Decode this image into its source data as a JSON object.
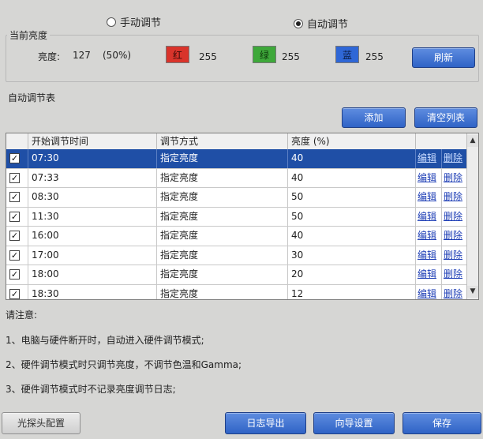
{
  "mode": {
    "manual_label": "手动调节",
    "auto_label": "自动调节",
    "selected": "auto"
  },
  "current": {
    "group_title": "当前亮度",
    "brightness_label": "亮度:",
    "brightness_value": "127",
    "brightness_percent": "(50%)",
    "red_label": "红",
    "red_value": "255",
    "green_label": "绿",
    "green_value": "255",
    "blue_label": "蓝",
    "blue_value": "255",
    "red_color": "#d9342b",
    "green_color": "#3ea83a",
    "blue_color": "#2f67d6",
    "refresh_label": "刷新"
  },
  "auto_table": {
    "group_title": "自动调节表",
    "add_label": "添加",
    "clear_label": "清空列表",
    "headers": [
      "开始调节时间",
      "调节方式",
      "亮度 (%)"
    ],
    "edit_label": "编辑",
    "delete_label": "删除",
    "rows": [
      {
        "time": "07:30",
        "method": "指定亮度",
        "brightness": "40",
        "checked": true,
        "selected": true
      },
      {
        "time": "07:33",
        "method": "指定亮度",
        "brightness": "40",
        "checked": true,
        "selected": false
      },
      {
        "time": "08:30",
        "method": "指定亮度",
        "brightness": "50",
        "checked": true,
        "selected": false
      },
      {
        "time": "11:30",
        "method": "指定亮度",
        "brightness": "50",
        "checked": true,
        "selected": false
      },
      {
        "time": "16:00",
        "method": "指定亮度",
        "brightness": "40",
        "checked": true,
        "selected": false
      },
      {
        "time": "17:00",
        "method": "指定亮度",
        "brightness": "30",
        "checked": true,
        "selected": false
      },
      {
        "time": "18:00",
        "method": "指定亮度",
        "brightness": "20",
        "checked": true,
        "selected": false
      },
      {
        "time": "18:30",
        "method": "指定亮度",
        "brightness": "12",
        "checked": true,
        "selected": false
      }
    ]
  },
  "notes": {
    "title": "请注意:",
    "lines": [
      "1、电脑与硬件断开时，自动进入硬件调节模式;",
      "2、硬件调节模式时只调节亮度，不调节色温和Gamma;",
      "3、硬件调节模式时不记录亮度调节日志;"
    ]
  },
  "footer": {
    "probe_config_label": "光探头配置",
    "export_log_label": "日志导出",
    "wizard_label": "向导设置",
    "save_label": "保存"
  }
}
